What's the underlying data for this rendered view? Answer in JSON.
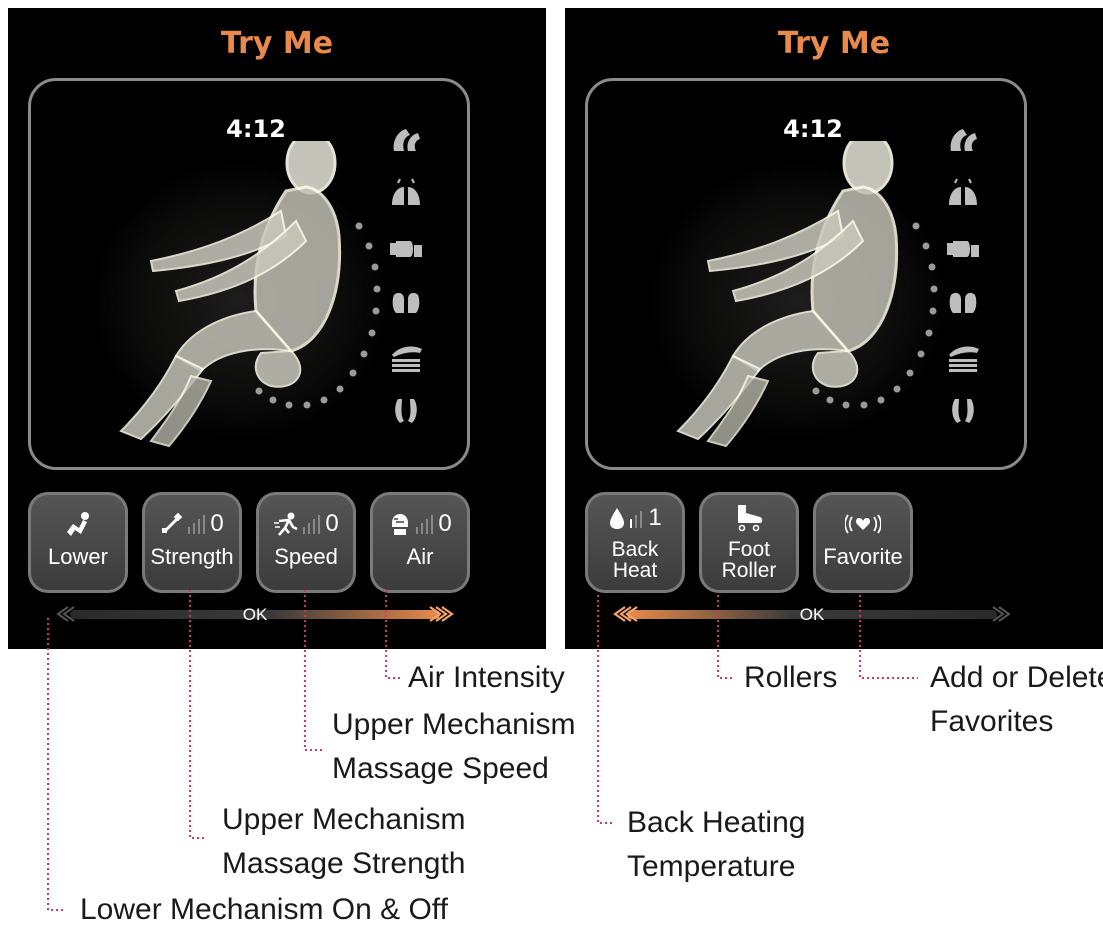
{
  "colors": {
    "title": "#e98a4b",
    "accent": "#e98a4b",
    "leader": "#d6336c",
    "button_bg": "#4a4a4a",
    "button_border": "#7a7a7a"
  },
  "left_panel": {
    "title": "Try Me",
    "timer": "4:12",
    "mode_icons": [
      "kneading-icon",
      "tapping-icon",
      "clapping-icon",
      "shiatsu-icon",
      "rolling-icon",
      "foot-massage-icon"
    ],
    "buttons": [
      {
        "icon": "lower-mechanism-icon",
        "level": "",
        "label": "Lower"
      },
      {
        "icon": "strength-icon",
        "level": "0",
        "label": "Strength"
      },
      {
        "icon": "speed-icon",
        "level": "0",
        "label": "Speed"
      },
      {
        "icon": "air-icon",
        "level": "0",
        "label": "Air"
      }
    ],
    "ok_label": "OK",
    "bar_arrow_direction": "right"
  },
  "right_panel": {
    "title": "Try Me",
    "timer": "4:12",
    "mode_icons": [
      "kneading-icon",
      "tapping-icon",
      "clapping-icon",
      "shiatsu-icon",
      "rolling-icon",
      "foot-massage-icon"
    ],
    "buttons": [
      {
        "icon": "heat-icon",
        "level": "1",
        "label_line1": "Back",
        "label_line2": "Heat"
      },
      {
        "icon": "foot-roller-icon",
        "level": "",
        "label_line1": "Foot",
        "label_line2": "Roller"
      },
      {
        "icon": "favorite-icon",
        "level": "",
        "label": "Favorite"
      }
    ],
    "ok_label": "OK",
    "bar_arrow_direction": "left"
  },
  "callouts": {
    "air_intensity": "Air Intensity",
    "speed_line1": "Upper Mechanism",
    "speed_line2": "Massage Speed",
    "strength_line1": "Upper Mechanism",
    "strength_line2": "Massage Strength",
    "lower": "Lower Mechanism On & Off",
    "rollers": "Rollers",
    "favorites_line1": "Add or Delete",
    "favorites_line2": "Favorites",
    "heat_line1": "Back Heating",
    "heat_line2": "Temperature"
  }
}
